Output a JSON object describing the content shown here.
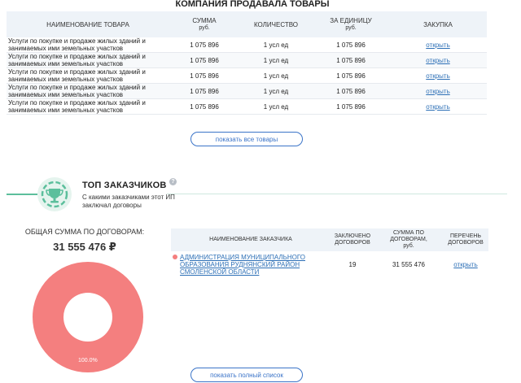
{
  "goods": {
    "title": "КОМПАНИЯ ПРОДАВАЛА ТОВАРЫ",
    "headers": {
      "name": "НАИМЕНОВАНИЕ ТОВАРА",
      "sum": "СУММА",
      "sum_unit": "руб.",
      "qty": "КОЛИЧЕСТВО",
      "unit_price": "ЗА ЕДИНИЦУ",
      "unit_price_unit": "руб.",
      "purchase": "ЗАКУПКА"
    },
    "rows": [
      {
        "name": "Услуги по покупке и продаже жилых зданий и занимаемых ими земельных участков",
        "sum": "1 075 896",
        "qty": "1 усл ед",
        "unit_price": "1 075 896",
        "link": "открыть"
      },
      {
        "name": "Услуги по покупке и продаже жилых зданий и занимаемых ими земельных участков",
        "sum": "1 075 896",
        "qty": "1 усл ед",
        "unit_price": "1 075 896",
        "link": "открыть"
      },
      {
        "name": "Услуги по покупке и продаже жилых зданий и занимаемых ими земельных участков",
        "sum": "1 075 896",
        "qty": "1 усл ед",
        "unit_price": "1 075 896",
        "link": "открыть"
      },
      {
        "name": "Услуги по покупке и продаже жилых зданий и занимаемых ими земельных участков",
        "sum": "1 075 896",
        "qty": "1 усл ед",
        "unit_price": "1 075 896",
        "link": "открыть"
      },
      {
        "name": "Услуги по покупке и продаже жилых зданий и занимаемых ими земельных участков",
        "sum": "1 075 896",
        "qty": "1 усл ед",
        "unit_price": "1 075 896",
        "link": "открыть"
      }
    ],
    "show_all_label": "показать все товары"
  },
  "top_customers": {
    "title": "ТОП ЗАКАЗЧИКОВ",
    "help_glyph": "?",
    "subtitle": "С какими заказчиками этот ИП заключал договоры",
    "icon": "trophy-icon",
    "total_label": "ОБЩАЯ СУММА ПО ДОГОВОРАМ:",
    "total_value": "31 555 476 ₽",
    "headers": {
      "name": "НАИМЕНОВАНИЕ ЗАКАЗЧИКА",
      "contracts": "ЗАКЛЮЧЕНО ДОГОВОРОВ",
      "sum": "СУММА ПО ДОГОВОРАМ,",
      "sum_unit": "руб.",
      "list": "ПЕРЕЧЕНЬ ДОГОВОРОВ"
    },
    "rows": [
      {
        "name": "АДМИНИСТРАЦИЯ МУНИЦИПАЛЬНОГО ОБРАЗОВАНИЯ РУДНЯНСКИЙ РАЙОН СМОЛЕНСКОЙ ОБЛАСТИ",
        "contracts": "19",
        "sum": "31 555 476",
        "link": "открыть",
        "color": "#f47f7f"
      }
    ],
    "show_full_label": "показать полный список"
  },
  "chart_data": {
    "type": "pie",
    "categories": [
      "АДМИНИСТРАЦИЯ МУНИЦИПАЛЬНОГО ОБРАЗОВАНИЯ РУДНЯНСКИЙ РАЙОН СМОЛЕНСКОЙ ОБЛАСТИ"
    ],
    "values": [
      100.0
    ],
    "labels": [
      "100.0%"
    ],
    "colors": [
      "#f47f7f"
    ]
  },
  "colors": {
    "accent": "#3b74c8",
    "green": "#5cbf9c",
    "pie": "#f47f7f"
  }
}
